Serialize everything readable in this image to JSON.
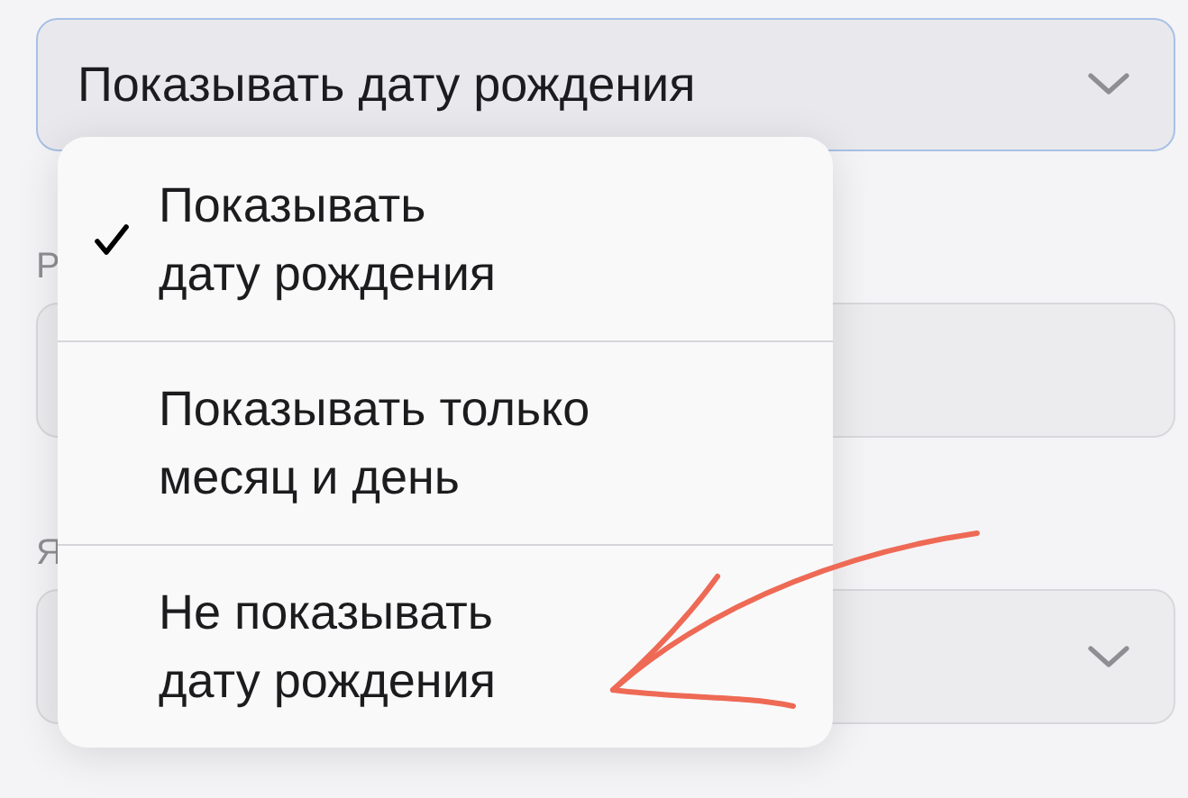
{
  "select": {
    "value": "Показывать дату рождения"
  },
  "fields": [
    {
      "label": "Р",
      "dropdown": false
    },
    {
      "label": "Я",
      "dropdown": true
    }
  ],
  "menu": {
    "items": [
      {
        "lines": [
          "Показывать",
          "дату рождения"
        ],
        "selected": true
      },
      {
        "lines": [
          "Показывать только",
          "месяц и день"
        ],
        "selected": false
      },
      {
        "lines": [
          "Не показывать",
          "дату рождения"
        ],
        "selected": false
      }
    ]
  }
}
